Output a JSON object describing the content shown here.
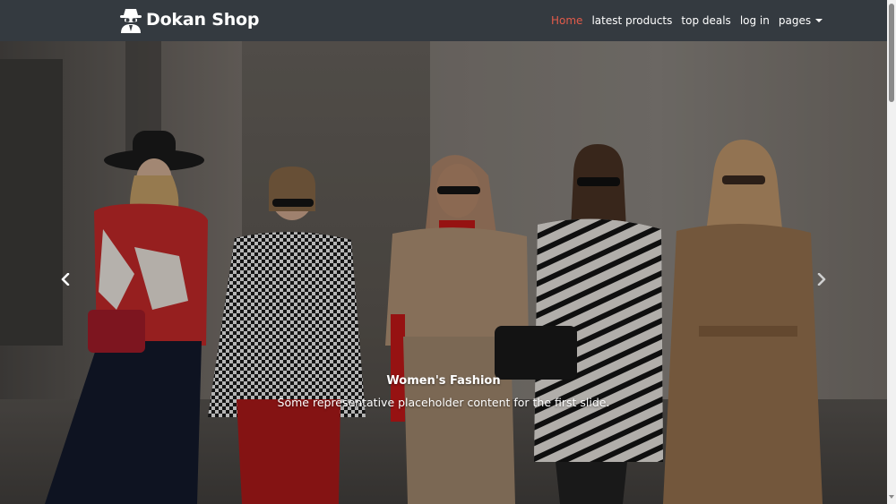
{
  "navbar": {
    "brand": "Dokan Shop",
    "logo_icon": "spy-icon",
    "links": [
      {
        "label": "Home",
        "active": true
      },
      {
        "label": "latest products",
        "active": false
      },
      {
        "label": "top deals",
        "active": false
      },
      {
        "label": "log in",
        "active": false
      },
      {
        "label": "pages",
        "active": false,
        "dropdown": true
      }
    ]
  },
  "carousel": {
    "caption_title": "Women's Fashion",
    "caption_text": "Some representative placeholder content for the first slide.",
    "prev_icon": "chevron-left-icon",
    "next_icon": "chevron-right-icon"
  },
  "colors": {
    "navbar_bg": "#343a40",
    "active_link": "#e25b4a",
    "text": "#ffffff"
  }
}
